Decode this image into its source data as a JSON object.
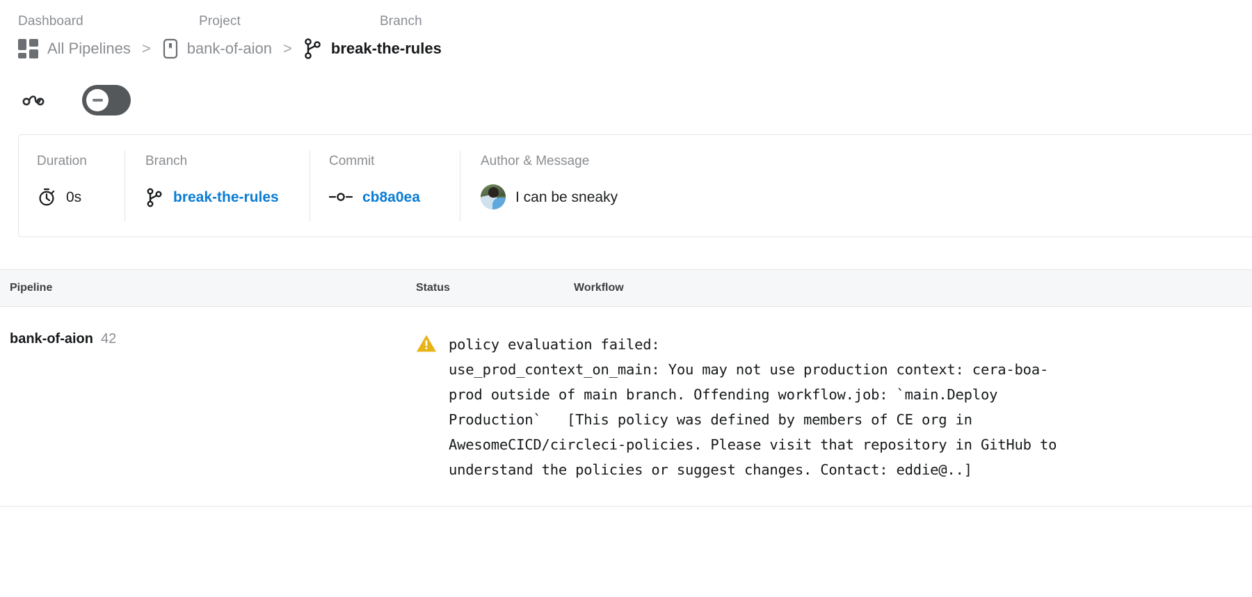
{
  "breadcrumb": {
    "labels": {
      "dashboard": "Dashboard",
      "project": "Project",
      "branch": "Branch"
    },
    "items": [
      {
        "text": "All Pipelines",
        "icon": "grid-icon"
      },
      {
        "text": "bank-of-aion",
        "icon": "project-icon"
      },
      {
        "text": "break-the-rules",
        "icon": "branch-icon"
      }
    ],
    "separator": ">"
  },
  "toolbar": {
    "workflow_icon": "workflow-icon",
    "status": {
      "state": "cancelled",
      "icon": "minus-circle-icon",
      "pill_color": "#55585b"
    }
  },
  "info_card": {
    "duration": {
      "title": "Duration",
      "value": "0s",
      "icon": "stopwatch-icon"
    },
    "branch": {
      "title": "Branch",
      "value": "break-the-rules",
      "icon": "branch-icon",
      "link_color": "#0a7cd4"
    },
    "commit": {
      "title": "Commit",
      "value": "cb8a0ea",
      "icon": "commit-node-icon",
      "link_color": "#0a7cd4"
    },
    "author": {
      "title": "Author & Message",
      "message": "I can be sneaky",
      "avatar": "user-avatar"
    }
  },
  "table": {
    "headers": {
      "pipeline": "Pipeline",
      "status": "Status",
      "workflow": "Workflow"
    },
    "rows": [
      {
        "pipeline_name": "bank-of-aion",
        "pipeline_number": "42",
        "status_icon": "warning-triangle-icon",
        "status_icon_color": "#e8b317",
        "status_message": "policy evaluation failed:\nuse_prod_context_on_main: You may not use production context: cera-boa-\nprod outside of main branch. Offending workflow.job: `main.Deploy\nProduction`   [This policy was defined by members of CE org in\nAwesomeCICD/circleci-policies. Please visit that repository in GitHub to\nunderstand the policies or suggest changes. Contact: eddie@..]"
      }
    ]
  }
}
